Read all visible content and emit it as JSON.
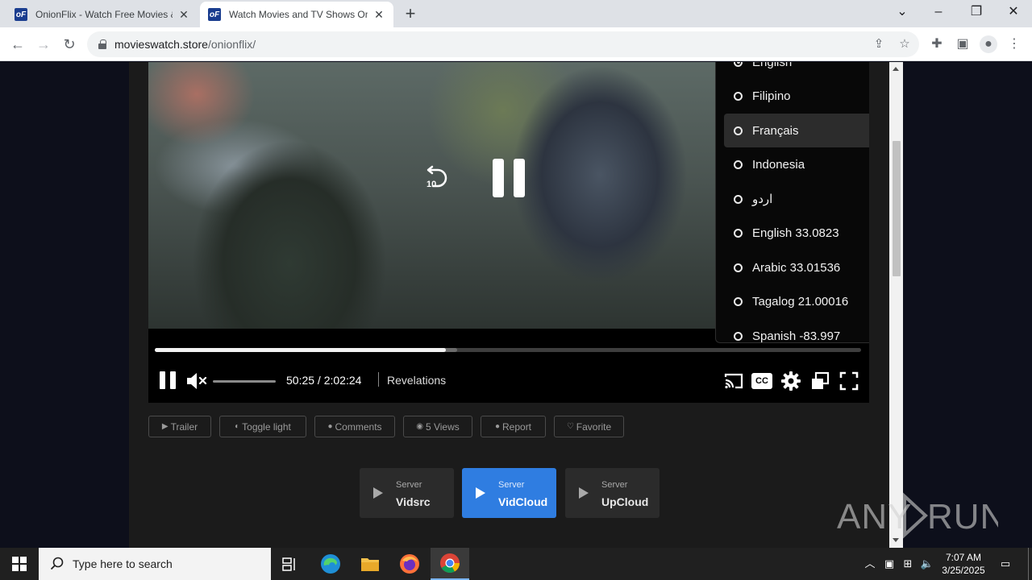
{
  "browser": {
    "tabs": [
      {
        "title": "OnionFlix - Watch Free Movies &",
        "favicon": "oF",
        "active": false
      },
      {
        "title": "Watch Movies and TV Shows On",
        "favicon": "oF",
        "active": true
      }
    ],
    "address": {
      "domain": "movieswatch.store",
      "path": "/onionflix/"
    }
  },
  "player": {
    "current_time": "50:25",
    "duration": "2:02:24",
    "time_display": "50:25 / 2:02:24",
    "episode_title": "Revelations",
    "progress_played_fraction": 0.412,
    "progress_loaded_fraction": 0.428,
    "volume_muted": true,
    "rewind_seconds": "10",
    "cc_label": "CC",
    "subtitle_menu": {
      "items": [
        {
          "label": "English",
          "checked": true
        },
        {
          "label": "Filipino",
          "checked": false
        },
        {
          "label": "Français",
          "checked": false,
          "hover": true
        },
        {
          "label": "Indonesia",
          "checked": false
        },
        {
          "label": "اردو",
          "checked": false
        },
        {
          "label": "English 33.0823",
          "checked": false
        },
        {
          "label": "Arabic 33.01536",
          "checked": false
        },
        {
          "label": "Tagalog 21.00016",
          "checked": false
        },
        {
          "label": "Spanish -83.997",
          "checked": false
        }
      ]
    }
  },
  "actions": [
    {
      "label": "Trailer",
      "icon": "youtube-icon"
    },
    {
      "label": "Toggle light",
      "icon": "adjust-icon"
    },
    {
      "label": "Comments",
      "icon": "comment-icon"
    },
    {
      "label": "5 Views",
      "icon": "eye-icon"
    },
    {
      "label": "Report",
      "icon": "alert-icon"
    },
    {
      "label": "Favorite",
      "icon": "heart-icon"
    }
  ],
  "servers": [
    {
      "caption": "Server",
      "name": "Vidsrc",
      "active": false
    },
    {
      "caption": "Server",
      "name": "VidCloud",
      "active": true
    },
    {
      "caption": "Server",
      "name": "UpCloud",
      "active": false
    }
  ],
  "watermark": "ANY RUN",
  "taskbar": {
    "search_placeholder": "Type here to search",
    "time": "7:07 AM",
    "date": "3/25/2025"
  },
  "colors": {
    "accent": "#2f7de1",
    "page_bg": "#0d0f1b",
    "site_bg": "#1b1b1b"
  }
}
